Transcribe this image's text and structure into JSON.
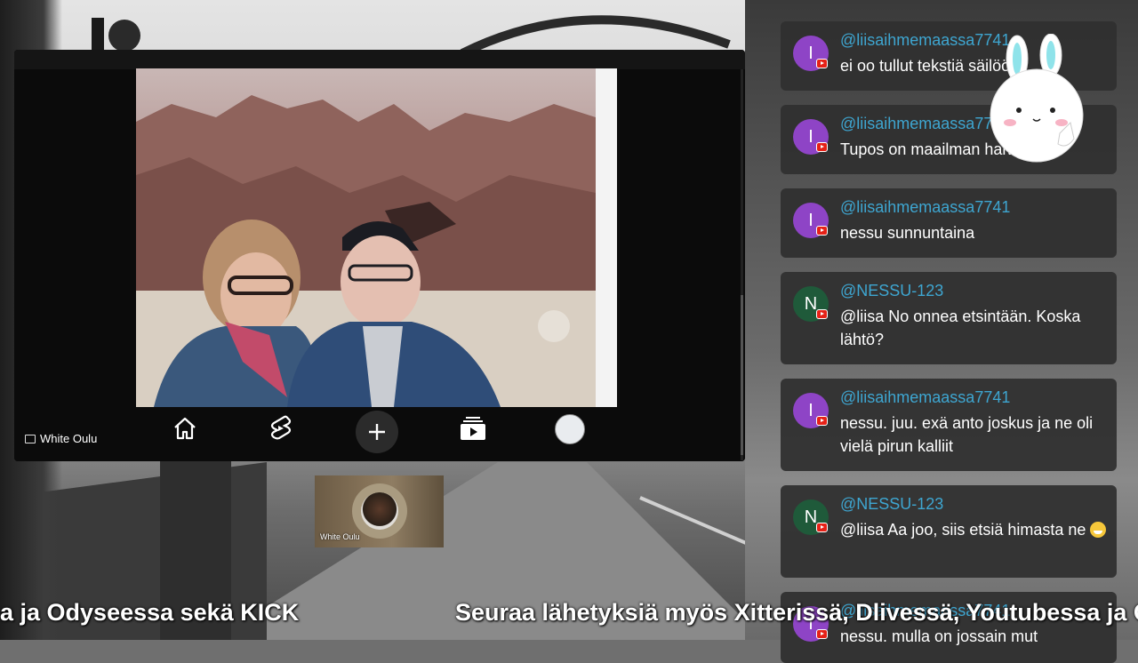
{
  "video": {
    "cast_label": "White Oulu"
  },
  "thumbnail": {
    "label": "White Oulu"
  },
  "chat": {
    "messages": [
      {
        "initial": "I",
        "color": "purple",
        "user": "@liisaihmemaassa7741",
        "text": "ei oo tullut tekstiä säilöön"
      },
      {
        "initial": "I",
        "color": "purple",
        "user": "@liisaihmemaassa7741",
        "text": "Tupos on maailman halvin"
      },
      {
        "initial": "I",
        "color": "purple",
        "user": "@liisaihmemaassa7741",
        "text": "nessu sunnuntaina"
      },
      {
        "initial": "N",
        "color": "green",
        "user": "@NESSU-123",
        "text": "@liisa No onnea etsintään. Koska lähtö?"
      },
      {
        "initial": "I",
        "color": "purple",
        "user": "@liisaihmemaassa7741",
        "text": "nessu. juu. exä anto joskus ja ne oli vielä pirun kalliit"
      },
      {
        "initial": "N",
        "color": "green",
        "user": "@NESSU-123",
        "text": "@liisa Aa joo, siis etsiä himasta ne"
      },
      {
        "initial": "I",
        "color": "purple",
        "user": "@liisaihmemaassa7741",
        "text": "nessu. mulla on jossain mut"
      }
    ]
  },
  "ticker": {
    "left_text": "a ja Odyseessa sekä KICK",
    "right_text": "Seuraa lähetyksiä myös Xitterissä, Dlivessä, Youtubessa ja O"
  },
  "icons": [
    "home-icon",
    "shorts-icon",
    "plus-icon",
    "subscriptions-icon",
    "profile-avatar",
    "cast-icon",
    "youtube-badge-icon"
  ],
  "colors": {
    "username": "#3ea6d1",
    "avatar_purple": "#8e44c6",
    "avatar_green": "#1f5a3a",
    "chat_bg": "#303030",
    "yt_red": "#e62117"
  }
}
